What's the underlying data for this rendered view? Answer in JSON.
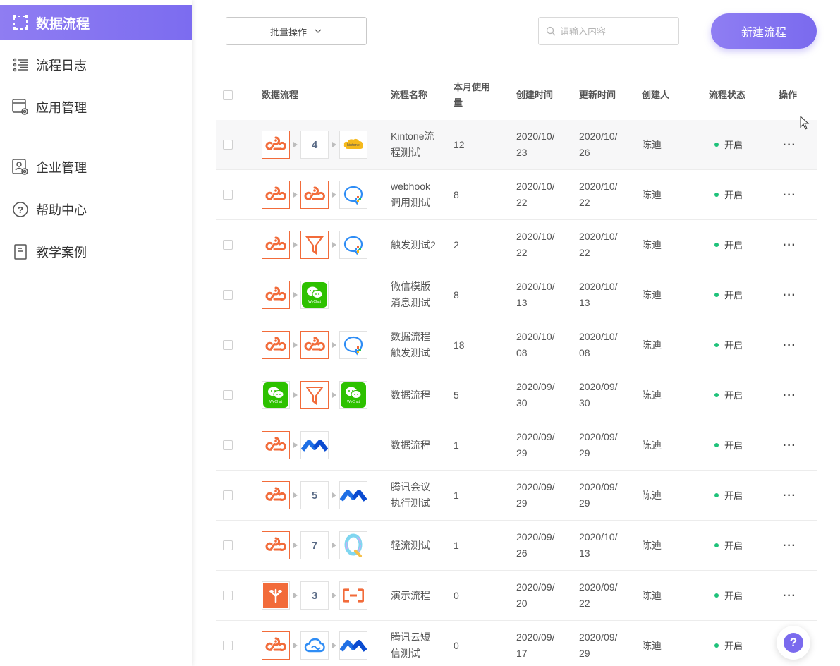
{
  "sidebar": {
    "items": [
      {
        "label": "数据流程",
        "icon": "dashed-frame-icon",
        "active": true
      },
      {
        "label": "流程日志",
        "icon": "list-icon"
      },
      {
        "label": "应用管理",
        "icon": "app-settings-icon"
      },
      {
        "label": "企业管理",
        "icon": "enterprise-settings-icon"
      },
      {
        "label": "帮助中心",
        "icon": "question-circle-icon"
      },
      {
        "label": "教学案例",
        "icon": "document-icon"
      }
    ]
  },
  "toolbar": {
    "batch_label": "批量操作",
    "search_placeholder": "请输入内容",
    "new_label": "新建流程"
  },
  "table": {
    "headers": {
      "flow": "数据流程",
      "name": "流程名称",
      "usage_line1": "本月使用",
      "usage_line2": "量",
      "created": "创建时间",
      "updated": "更新时间",
      "creator": "创建人",
      "status": "流程状态",
      "action": "操作"
    },
    "rows": [
      {
        "nodes": [
          {
            "t": "webhook"
          },
          {
            "t": "num",
            "v": "4"
          },
          {
            "t": "kintone"
          }
        ],
        "name1": "Kintone流",
        "name2": "程测试",
        "usage": "12",
        "c1": "2020/10/",
        "c2": "23",
        "u1": "2020/10/",
        "u2": "26",
        "creator": "陈迪",
        "status": "开启"
      },
      {
        "nodes": [
          {
            "t": "webhook"
          },
          {
            "t": "webhook"
          },
          {
            "t": "chat"
          }
        ],
        "name1": "webhook",
        "name2": "调用测试",
        "usage": "8",
        "c1": "2020/10/",
        "c2": "22",
        "u1": "2020/10/",
        "u2": "22",
        "creator": "陈迪",
        "status": "开启"
      },
      {
        "nodes": [
          {
            "t": "webhook"
          },
          {
            "t": "filter"
          },
          {
            "t": "chat"
          }
        ],
        "name1": "触发测试2",
        "name2": "",
        "usage": "2",
        "c1": "2020/10/",
        "c2": "22",
        "u1": "2020/10/",
        "u2": "22",
        "creator": "陈迪",
        "status": "开启"
      },
      {
        "nodes": [
          {
            "t": "webhook"
          },
          {
            "t": "wechat"
          }
        ],
        "name1": "微信模版",
        "name2": "消息测试",
        "usage": "8",
        "c1": "2020/10/",
        "c2": "13",
        "u1": "2020/10/",
        "u2": "13",
        "creator": "陈迪",
        "status": "开启"
      },
      {
        "nodes": [
          {
            "t": "webhook"
          },
          {
            "t": "webhook"
          },
          {
            "t": "chat"
          }
        ],
        "name1": "数据流程",
        "name2": "触发测试",
        "usage": "18",
        "c1": "2020/10/",
        "c2": "08",
        "u1": "2020/10/",
        "u2": "08",
        "creator": "陈迪",
        "status": "开启"
      },
      {
        "nodes": [
          {
            "t": "wechat"
          },
          {
            "t": "filter"
          },
          {
            "t": "wechat"
          }
        ],
        "name1": "数据流程",
        "name2": "",
        "usage": "5",
        "c1": "2020/09/",
        "c2": "30",
        "u1": "2020/09/",
        "u2": "30",
        "creator": "陈迪",
        "status": "开启"
      },
      {
        "nodes": [
          {
            "t": "webhook"
          },
          {
            "t": "mlogo"
          }
        ],
        "name1": "数据流程",
        "name2": "",
        "usage": "1",
        "c1": "2020/09/",
        "c2": "29",
        "u1": "2020/09/",
        "u2": "29",
        "creator": "陈迪",
        "status": "开启"
      },
      {
        "nodes": [
          {
            "t": "webhook"
          },
          {
            "t": "num",
            "v": "5"
          },
          {
            "t": "mlogo"
          }
        ],
        "name1": "腾讯会议",
        "name2": "执行测试",
        "usage": "1",
        "c1": "2020/09/",
        "c2": "29",
        "u1": "2020/09/",
        "u2": "29",
        "creator": "陈迪",
        "status": "开启"
      },
      {
        "nodes": [
          {
            "t": "webhook"
          },
          {
            "t": "num",
            "v": "7"
          },
          {
            "t": "qlogo"
          }
        ],
        "name1": "轻流测试",
        "name2": "",
        "usage": "1",
        "c1": "2020/09/",
        "c2": "26",
        "u1": "2020/10/",
        "u2": "13",
        "creator": "陈迪",
        "status": "开启"
      },
      {
        "nodes": [
          {
            "t": "leaf"
          },
          {
            "t": "num",
            "v": "3"
          },
          {
            "t": "aliyun"
          }
        ],
        "name1": "演示流程",
        "name2": "",
        "usage": "0",
        "c1": "2020/09/",
        "c2": "20",
        "u1": "2020/09/",
        "u2": "22",
        "creator": "陈迪",
        "status": "开启"
      },
      {
        "nodes": [
          {
            "t": "webhook"
          },
          {
            "t": "cloud"
          },
          {
            "t": "mlogo"
          }
        ],
        "name1": "腾讯云短",
        "name2": "信测试",
        "usage": "0",
        "c1": "2020/09/",
        "c2": "17",
        "u1": "2020/09/",
        "u2": "29",
        "creator": "陈迪",
        "status": "开启"
      }
    ]
  },
  "help_label": "?",
  "colors": {
    "accent": "#7c6cf0",
    "orange": "#f26b3a",
    "status_green": "#1ec27a",
    "wechat_green": "#2dc100"
  }
}
